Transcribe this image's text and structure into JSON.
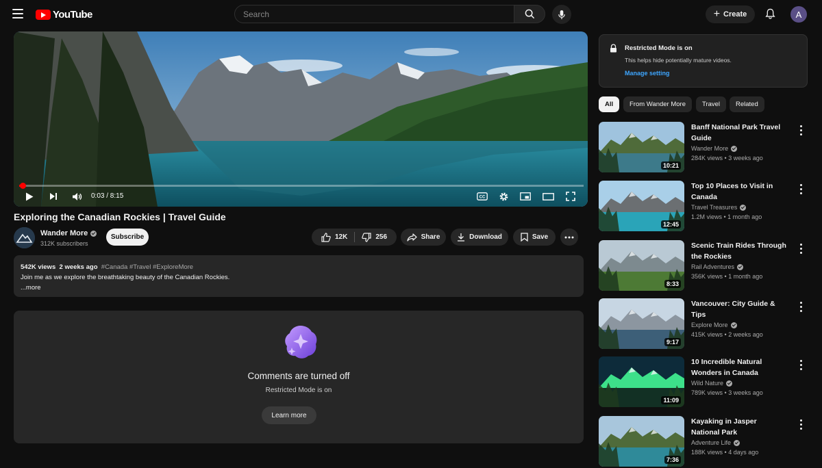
{
  "header": {
    "logo_text": "YouTube",
    "search_placeholder": "Search",
    "create_label": "Create",
    "avatar_letter": "A"
  },
  "player": {
    "time": "0:03 / 8:15",
    "progress": 0.006
  },
  "video": {
    "title": "Exploring the Canadian Rockies | Travel Guide",
    "channel": "Wander More",
    "subscribers": "312K subscribers",
    "subscribe_label": "Subscribe",
    "likes": "12K",
    "dislikes": "256",
    "share_label": "Share",
    "download_label": "Download",
    "save_label": "Save"
  },
  "description": {
    "views": "542K views",
    "age": "2 weeks ago",
    "tags": "#Canada #Travel #ExploreMore",
    "text": "Join me as we explore the breathtaking beauty of the Canadian Rockies.",
    "more": "...more"
  },
  "comments": {
    "title": "Comments are turned off",
    "subtitle": "Restricted Mode is on",
    "learn_more": "Learn more"
  },
  "restricted": {
    "title": "Restricted Mode is on",
    "text": "This helps hide potentially mature videos.",
    "link": "Manage setting"
  },
  "chips": [
    "All",
    "From Wander More",
    "Travel",
    "Related"
  ],
  "recommendations": [
    {
      "title": "Banff National Park Travel Guide",
      "channel": "Wander More",
      "views": "284K views",
      "age": "3 weeks ago",
      "duration": "10:21",
      "sky": "#9fc3de",
      "ground": "#3d7a8a",
      "accent": "#4f6b3a"
    },
    {
      "title": "Top 10 Places to Visit in Canada",
      "channel": "Travel Treasures",
      "views": "1.2M views",
      "age": "1 month ago",
      "duration": "12:45",
      "sky": "#a9cfe8",
      "ground": "#2aa4b8",
      "accent": "#6b6f72"
    },
    {
      "title": "Scenic Train Rides Through the Rockies",
      "channel": "Rail Adventures",
      "views": "356K views",
      "age": "1 month ago",
      "duration": "8:33",
      "sky": "#b9c9d4",
      "ground": "#4d7a35",
      "accent": "#7d8a8f"
    },
    {
      "title": "Vancouver: City Guide & Tips",
      "channel": "Explore More",
      "views": "415K views",
      "age": "2 weeks ago",
      "duration": "9:17",
      "sky": "#c7d6e3",
      "ground": "#3d5f78",
      "accent": "#8c96a0"
    },
    {
      "title": "10 Incredible Natural Wonders in Canada",
      "channel": "Wild Nature",
      "views": "789K views",
      "age": "3 weeks ago",
      "duration": "11:09",
      "sky": "#0d2b3a",
      "ground": "#123024",
      "accent": "#3de08a"
    },
    {
      "title": "Kayaking in Jasper National Park",
      "channel": "Adventure Life",
      "views": "188K views",
      "age": "4 days ago",
      "duration": "7:36",
      "sky": "#a8c6dc",
      "ground": "#2f8a99",
      "accent": "#4f6b3a"
    }
  ]
}
